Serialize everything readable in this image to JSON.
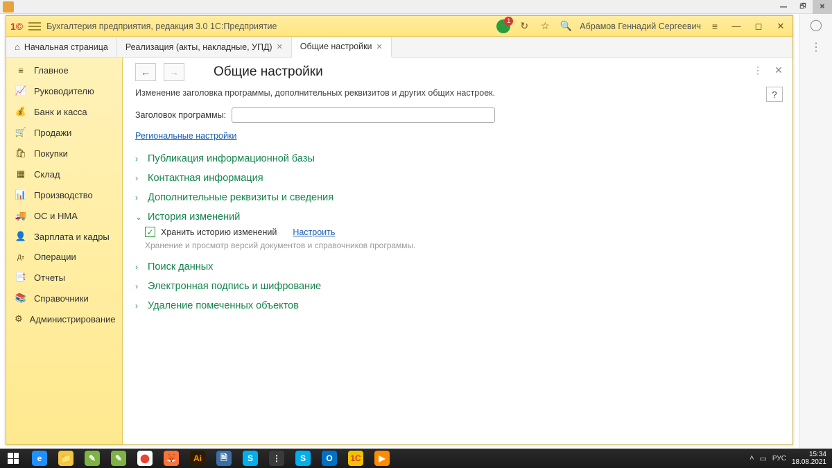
{
  "outer_window": {
    "min": "—",
    "max": "❐",
    "close": "✕",
    "restore": "🗗"
  },
  "app": {
    "title": "Бухгалтерия предприятия, редакция 3.0 1С:Предприятие",
    "user": "Абрамов Геннадий Сергеевич",
    "badge_count": "1"
  },
  "tabs": [
    {
      "label": "Начальная страница",
      "closable": false,
      "icon": "home"
    },
    {
      "label": "Реализация (акты, накладные, УПД)",
      "closable": true
    },
    {
      "label": "Общие настройки",
      "closable": true,
      "active": true
    }
  ],
  "sidebar": [
    {
      "icon": "≡",
      "label": "Главное"
    },
    {
      "icon": "📈",
      "label": "Руководителю"
    },
    {
      "icon": "💰",
      "label": "Банк и касса"
    },
    {
      "icon": "🛒",
      "label": "Продажи"
    },
    {
      "icon": "🛍",
      "label": "Покупки"
    },
    {
      "icon": "▦",
      "label": "Склад"
    },
    {
      "icon": "📊",
      "label": "Производство"
    },
    {
      "icon": "🚚",
      "label": "ОС и НМА"
    },
    {
      "icon": "👤",
      "label": "Зарплата и кадры"
    },
    {
      "icon": "Дт",
      "label": "Операции"
    },
    {
      "icon": "📑",
      "label": "Отчеты"
    },
    {
      "icon": "📚",
      "label": "Справочники"
    },
    {
      "icon": "⚙",
      "label": "Администрирование"
    }
  ],
  "page": {
    "title": "Общие настройки",
    "description": "Изменение заголовка программы, дополнительных реквизитов и других общих настроек.",
    "field_label": "Заголовок программы:",
    "field_value": "",
    "regional_link": "Региональные настройки",
    "help": "?"
  },
  "sections": [
    {
      "title": "Публикация информационной базы",
      "open": false
    },
    {
      "title": "Контактная информация",
      "open": false
    },
    {
      "title": "Дополнительные реквизиты и сведения",
      "open": false
    },
    {
      "title": "История изменений",
      "open": true,
      "checkbox_label": "Хранить историю изменений",
      "checkbox_checked": true,
      "config_link": "Настроить",
      "hint": "Хранение и просмотр версий документов и справочников программы."
    },
    {
      "title": "Поиск данных",
      "open": false
    },
    {
      "title": "Электронная подпись и шифрование",
      "open": false
    },
    {
      "title": "Удаление помеченных объектов",
      "open": false
    }
  ],
  "taskbar": {
    "items": [
      {
        "bg": "#1e90ff",
        "txt": "e"
      },
      {
        "bg": "#f4c542",
        "txt": "📁"
      },
      {
        "bg": "#7cb342",
        "txt": "✎"
      },
      {
        "bg": "#7cb342",
        "txt": "✎"
      },
      {
        "bg": "#ffffff",
        "txt": "⬤",
        "fg": "#ea4335"
      },
      {
        "bg": "#ff7139",
        "txt": "🦊"
      },
      {
        "bg": "#2d1b00",
        "txt": "Ai",
        "fg": "#ff9a00"
      },
      {
        "bg": "#3b6ea5",
        "txt": "🗎"
      },
      {
        "bg": "#00aff0",
        "txt": "S"
      },
      {
        "bg": "#3a3a3a",
        "txt": "⋮"
      },
      {
        "bg": "#00aff0",
        "txt": "S"
      },
      {
        "bg": "#0072c6",
        "txt": "O"
      },
      {
        "bg": "#f2c200",
        "txt": "1C",
        "fg": "#d63a2e"
      },
      {
        "bg": "#ff8c00",
        "txt": "▶"
      }
    ],
    "lang": "РУС",
    "time": "15:34",
    "date": "18.08.2021"
  }
}
